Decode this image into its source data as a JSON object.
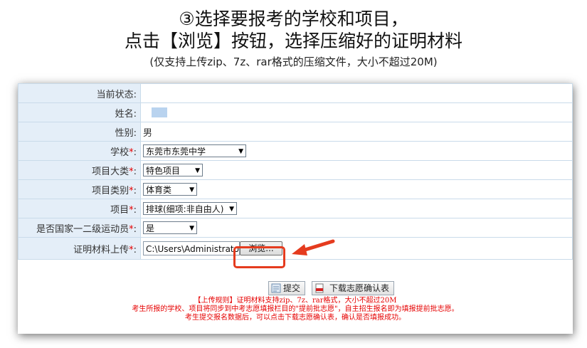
{
  "heading": {
    "line1": "③选择要报考的学校和项目，",
    "line2": "点击【浏览】按钮，选择压缩好的证明材料",
    "subtitle": "(仅支持上传zip、7z、rar格式的压缩文件，大小不超过20M)"
  },
  "form": {
    "status_label": "当前状态:",
    "name_label": "姓名:",
    "gender_label": "性别:",
    "gender_value": "男",
    "school_label": "学校",
    "school_value": "东莞市东莞中学",
    "category_label": "项目大类",
    "category_value": "特色项目",
    "type_label": "项目类别",
    "type_value": "体育类",
    "project_label": "项目",
    "project_value": "排球(细项:非自由人)",
    "athlete_label": "是否国家一二级运动员",
    "athlete_value": "是",
    "upload_label": "证明材料上传",
    "upload_value": "C:\\Users\\Administrator\\D",
    "browse_label": "浏览...",
    "required_mark": "*",
    "colon": ":"
  },
  "buttons": {
    "submit_label": "提交",
    "download_label": "下载志愿确认表"
  },
  "notes": {
    "line1": "【上传规则】证明材料支持zip、7z、rar格式，大小不超过20M",
    "line2": "考生所报的学校、项目将同步到中考志愿填报栏目的\"提前批志愿\"，自主招生报名即为填报提前批志愿。",
    "line3": "考生提交报名数据后，可以点击下载志愿确认表，确认是否填报成功。"
  },
  "colors": {
    "highlight": "#e53b1e",
    "required": "#e60000",
    "label_bg": "#e4eef8"
  },
  "icons": [
    "submit-icon",
    "pdf-icon",
    "arrow-icon"
  ]
}
